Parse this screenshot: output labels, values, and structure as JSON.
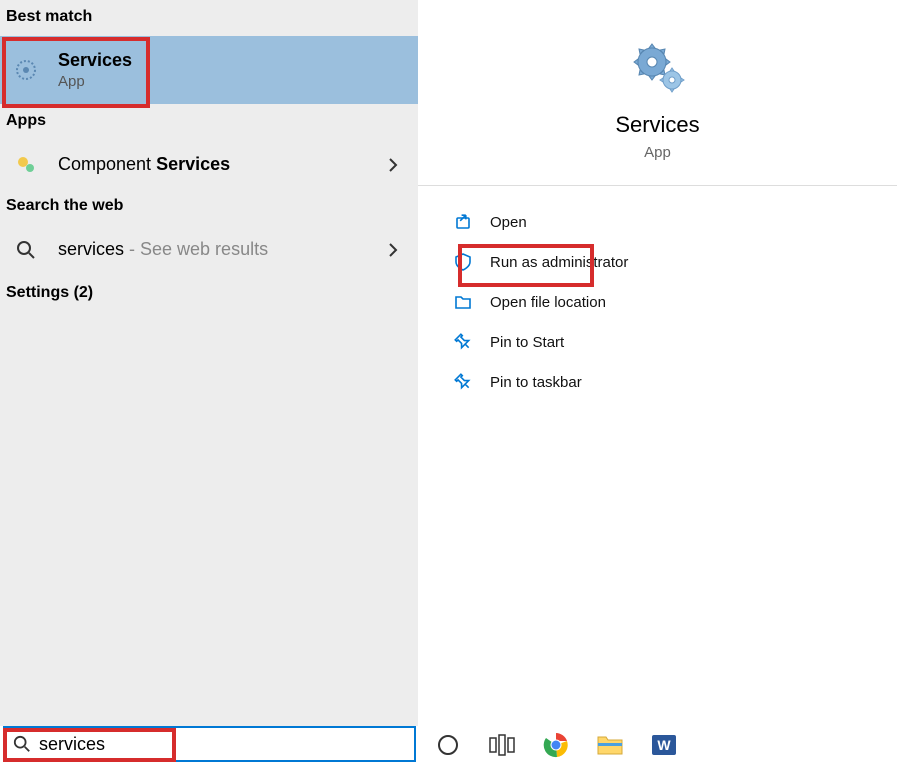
{
  "left": {
    "best_match_label": "Best match",
    "best_match": {
      "title": "Services",
      "subtitle": "App"
    },
    "apps_label": "Apps",
    "apps_item": {
      "prefix": "Component ",
      "bold": "Services"
    },
    "web_label": "Search the web",
    "web_item": {
      "query": "services",
      "hint": " - See web results"
    },
    "settings_label": "Settings (2)"
  },
  "detail": {
    "title": "Services",
    "subtitle": "App",
    "actions": [
      {
        "label": "Open"
      },
      {
        "label": "Run as administrator"
      },
      {
        "label": "Open file location"
      },
      {
        "label": "Pin to Start"
      },
      {
        "label": "Pin to taskbar"
      }
    ]
  },
  "search": {
    "value": "services"
  }
}
